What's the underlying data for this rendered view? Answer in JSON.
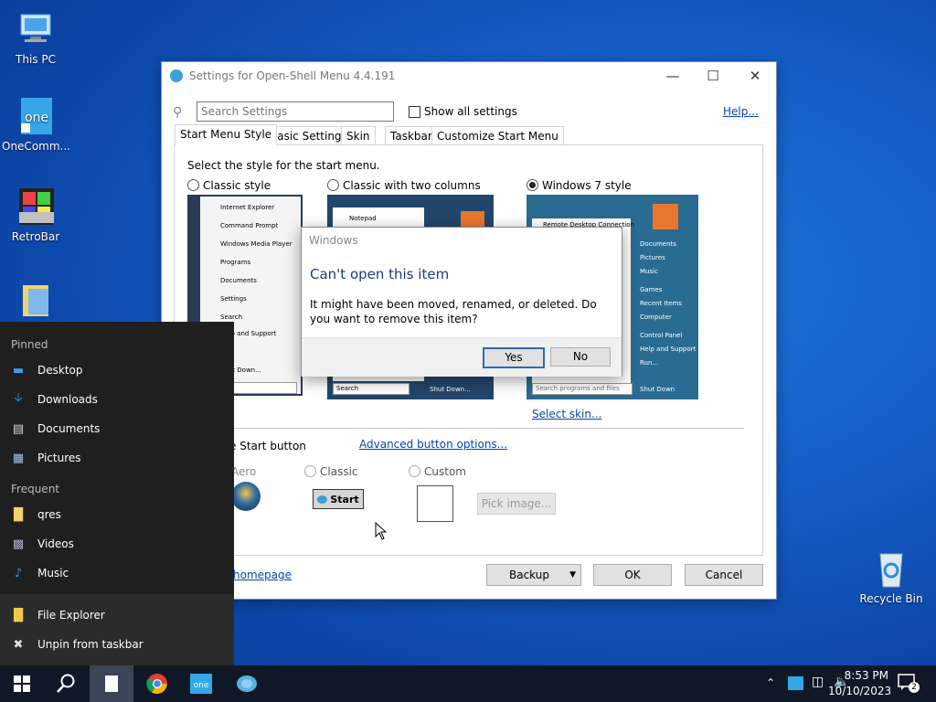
{
  "desktop": {
    "icons": [
      {
        "label": "This PC",
        "icon": "computer-icon"
      },
      {
        "label": "OneComm...",
        "icon": "onecommander-icon"
      },
      {
        "label": "RetroBar",
        "icon": "retrobar-icon"
      },
      {
        "label": "Recycle Bin",
        "icon": "recycle-bin-icon"
      }
    ]
  },
  "settings_window": {
    "title": "Settings for Open-Shell Menu 4.4.191",
    "search_placeholder": "Search Settings",
    "show_all_label": "Show all settings",
    "show_all_checked": false,
    "help_label": "Help...",
    "tabs": [
      "Start Menu Style",
      "Basic Settings",
      "Skin",
      "Taskbar",
      "Customize Start Menu"
    ],
    "active_tab": "Start Menu Style",
    "select_style_label": "Select the style for the start menu.",
    "styles": [
      {
        "label": "Classic style",
        "selected": false
      },
      {
        "label": "Classic with two columns",
        "selected": false
      },
      {
        "label": "Windows 7 style",
        "selected": true
      }
    ],
    "classic_items": [
      "Internet Explorer",
      "Command Prompt",
      "Windows Media Player",
      "Programs",
      "Documents",
      "Settings",
      "Search",
      "Help and Support",
      "Shut Down..."
    ],
    "twocol_items": [
      "Notepad",
      "Search",
      "Shut Down..."
    ],
    "win7_items_left": [
      "Remote Desktop Connection",
      "Search programs and files",
      "Shut Down"
    ],
    "win7_items_right": [
      "Documents",
      "Pictures",
      "Music",
      "Games",
      "Recent Items",
      "Computer",
      "Control Panel",
      "Help and Support",
      "Run..."
    ],
    "select_skin_label": "Select skin...",
    "replace_button_label": "e Start button",
    "advanced_button_label": "Advanced button options...",
    "button_styles": [
      {
        "label": "Aero",
        "selected": false
      },
      {
        "label": "Classic",
        "selected": false
      },
      {
        "label": "Custom",
        "selected": false
      }
    ],
    "start_preview_label": "Start",
    "pick_image_label": "Pick image...",
    "homepage_label": "homepage",
    "backup_label": "Backup",
    "ok_label": "OK",
    "cancel_label": "Cancel"
  },
  "dialog": {
    "title": "Windows",
    "heading": "Can't open this item",
    "message": "It might have been moved, renamed, or deleted. Do you want to remove this item?",
    "yes_label": "Yes",
    "no_label": "No"
  },
  "jump_list": {
    "pinned_header": "Pinned",
    "pinned": [
      {
        "label": "Desktop",
        "icon": "desktop-icon"
      },
      {
        "label": "Downloads",
        "icon": "downloads-icon"
      },
      {
        "label": "Documents",
        "icon": "documents-icon"
      },
      {
        "label": "Pictures",
        "icon": "pictures-icon"
      }
    ],
    "frequent_header": "Frequent",
    "frequent": [
      {
        "label": "qres",
        "icon": "folder-icon"
      },
      {
        "label": "Videos",
        "icon": "videos-icon"
      },
      {
        "label": "Music",
        "icon": "music-icon"
      }
    ],
    "actions": [
      {
        "label": "File Explorer",
        "icon": "file-explorer-icon"
      },
      {
        "label": "Unpin from taskbar",
        "icon": "unpin-icon"
      }
    ]
  },
  "taskbar": {
    "time": "8:53 PM",
    "date": "10/10/2023",
    "notification_count": "2"
  }
}
